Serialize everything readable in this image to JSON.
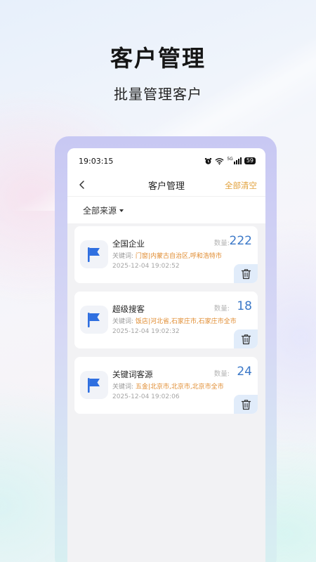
{
  "hero": {
    "title": "客户管理",
    "subtitle": "批量管理客户"
  },
  "status_bar": {
    "time": "19:03:15",
    "signal": "5G",
    "battery": "59"
  },
  "header": {
    "title": "客户管理",
    "clear_all": "全部清空"
  },
  "filter": {
    "label": "全部来源"
  },
  "labels": {
    "count_label": "数量:",
    "keyword_label": "关键词:"
  },
  "colors": {
    "accent_orange": "#e2a03a",
    "accent_blue": "#3b78c8",
    "keyword_orange": "#e08b2f",
    "delete_bg": "#e1ecfa"
  },
  "icons": {
    "back": "chevron-left-icon",
    "card": "flag-icon",
    "delete": "trash-icon"
  },
  "cards": [
    {
      "name": "全国企业",
      "count": "222",
      "keywords": "门窗|内蒙古自治区,呼和浩特市",
      "time": "2025-12-04 19:02:52"
    },
    {
      "name": "超级搜客",
      "count": "18",
      "keywords": "饭店|河北省,石家庄市,石家庄市全市",
      "time": "2025-12-04 19:02:32"
    },
    {
      "name": "关键词客源",
      "count": "24",
      "keywords": "五金|北京市,北京市,北京市全市",
      "time": "2025-12-04 19:02:06"
    }
  ]
}
